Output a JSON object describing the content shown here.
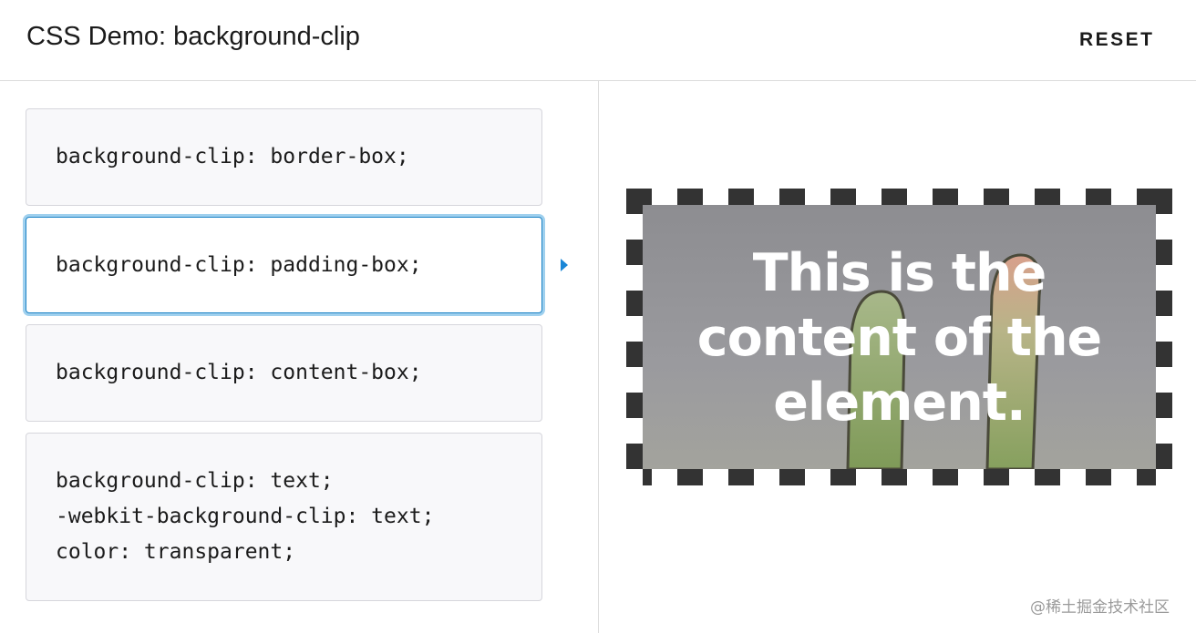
{
  "header": {
    "title": "CSS Demo: background-clip",
    "reset_label": "RESET"
  },
  "options": [
    {
      "lines": [
        "background-clip: border-box;"
      ],
      "selected": false
    },
    {
      "lines": [
        "background-clip: padding-box;"
      ],
      "selected": true
    },
    {
      "lines": [
        "background-clip: content-box;"
      ],
      "selected": false
    },
    {
      "lines": [
        "background-clip: text;",
        "-webkit-background-clip: text;",
        "color: transparent;"
      ],
      "selected": false
    }
  ],
  "example": {
    "text": "This is the content of the element."
  },
  "watermark": "@稀土掘金技术社区",
  "colors": {
    "accent": "#1b82c5",
    "focus_ring": "#9fd0ee",
    "arrow": "#1a86d6",
    "border_dash": "#333333"
  }
}
